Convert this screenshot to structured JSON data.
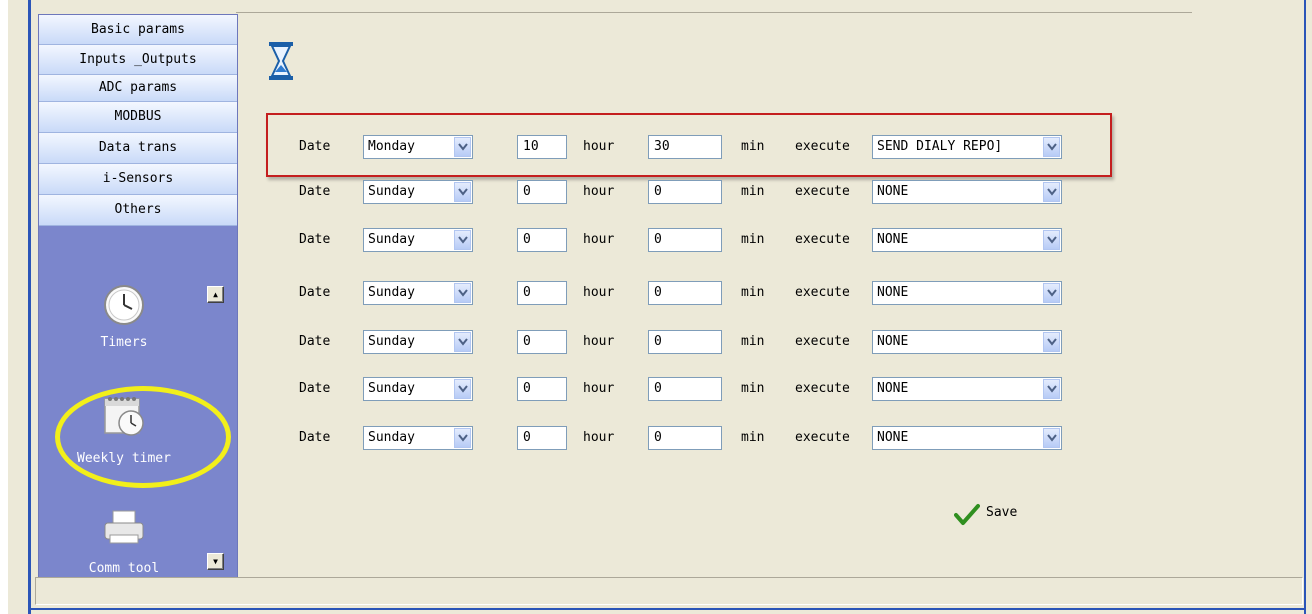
{
  "sidebar": {
    "categories": [
      "Basic params",
      "Inputs _Outputs",
      "ADC params",
      "MODBUS",
      "Data trans",
      "i-Sensors",
      "Others"
    ],
    "tools": [
      {
        "label": "Timers",
        "icon": "clock-icon"
      },
      {
        "label": "Weekly timer",
        "icon": "calendar-clock-icon"
      },
      {
        "label": "Comm tool",
        "icon": "printer-icon"
      }
    ]
  },
  "labels": {
    "date": "Date",
    "hour": "hour",
    "min": "min",
    "execute": "execute"
  },
  "rows": [
    {
      "day": "Monday",
      "hour": "10",
      "min": "30",
      "action": "SEND DIALY REPO]"
    },
    {
      "day": "Sunday",
      "hour": "0",
      "min": "0",
      "action": "NONE"
    },
    {
      "day": "Sunday",
      "hour": "0",
      "min": "0",
      "action": "NONE"
    },
    {
      "day": "Sunday",
      "hour": "0",
      "min": "0",
      "action": "NONE"
    },
    {
      "day": "Sunday",
      "hour": "0",
      "min": "0",
      "action": "NONE"
    },
    {
      "day": "Sunday",
      "hour": "0",
      "min": "0",
      "action": "NONE"
    },
    {
      "day": "Sunday",
      "hour": "0",
      "min": "0",
      "action": "NONE"
    }
  ],
  "save_label": "Save",
  "colors": {
    "sidebar_bg": "#7b86cc",
    "highlight_rect": "#c41e1e",
    "highlight_circle": "#f2ef1a",
    "window_bg": "#ece9d8"
  }
}
